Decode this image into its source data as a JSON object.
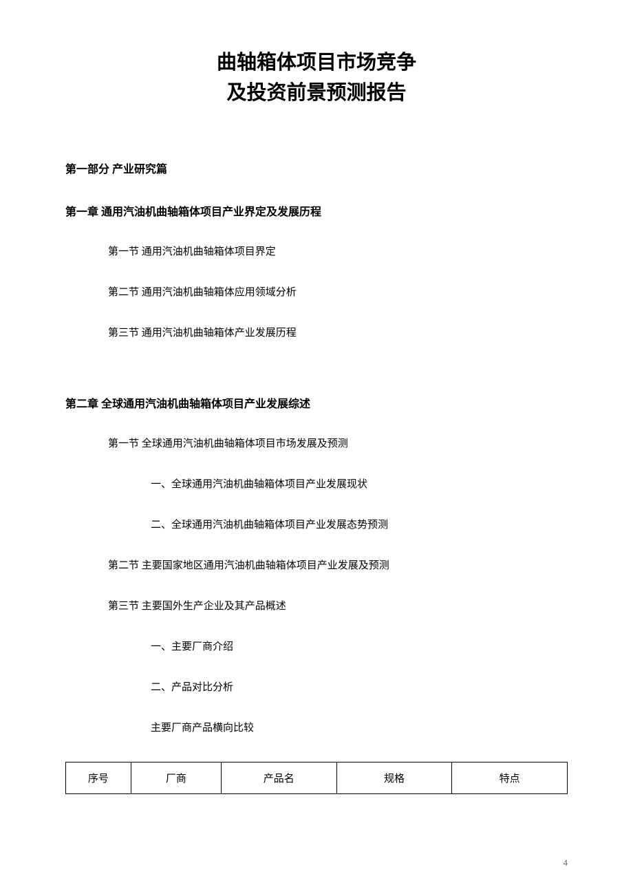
{
  "title": {
    "line1": "曲轴箱体项目市场竞争",
    "line2": "及投资前景预测报告"
  },
  "part1": {
    "heading": "第一部分 产业研究篇"
  },
  "chapter1": {
    "heading": "第一章  通用汽油机曲轴箱体项目产业界定及发展历程",
    "section1": "第一节  通用汽油机曲轴箱体项目界定",
    "section2": "第二节  通用汽油机曲轴箱体应用领域分析",
    "section3": "第三节  通用汽油机曲轴箱体产业发展历程"
  },
  "chapter2": {
    "heading": "第二章  全球通用汽油机曲轴箱体项目产业发展综述",
    "section1": "第一节  全球通用汽油机曲轴箱体项目市场发展及预测",
    "section1_sub1": "一、全球通用汽油机曲轴箱体项目产业发展现状",
    "section1_sub2": "二、全球通用汽油机曲轴箱体项目产业发展态势预测",
    "section2": "第二节  主要国家地区通用汽油机曲轴箱体项目产业发展及预测",
    "section3": "第三节  主要国外生产企业及其产品概述",
    "section3_sub1": "一、主要厂商介绍",
    "section3_sub2": "二、产品对比分析",
    "section3_sub3": "主要厂商产品横向比较"
  },
  "table": {
    "headers": {
      "col1": "序号",
      "col2": "厂商",
      "col3": "产品名",
      "col4": "规格",
      "col5": "特点"
    }
  },
  "page_number": "4"
}
